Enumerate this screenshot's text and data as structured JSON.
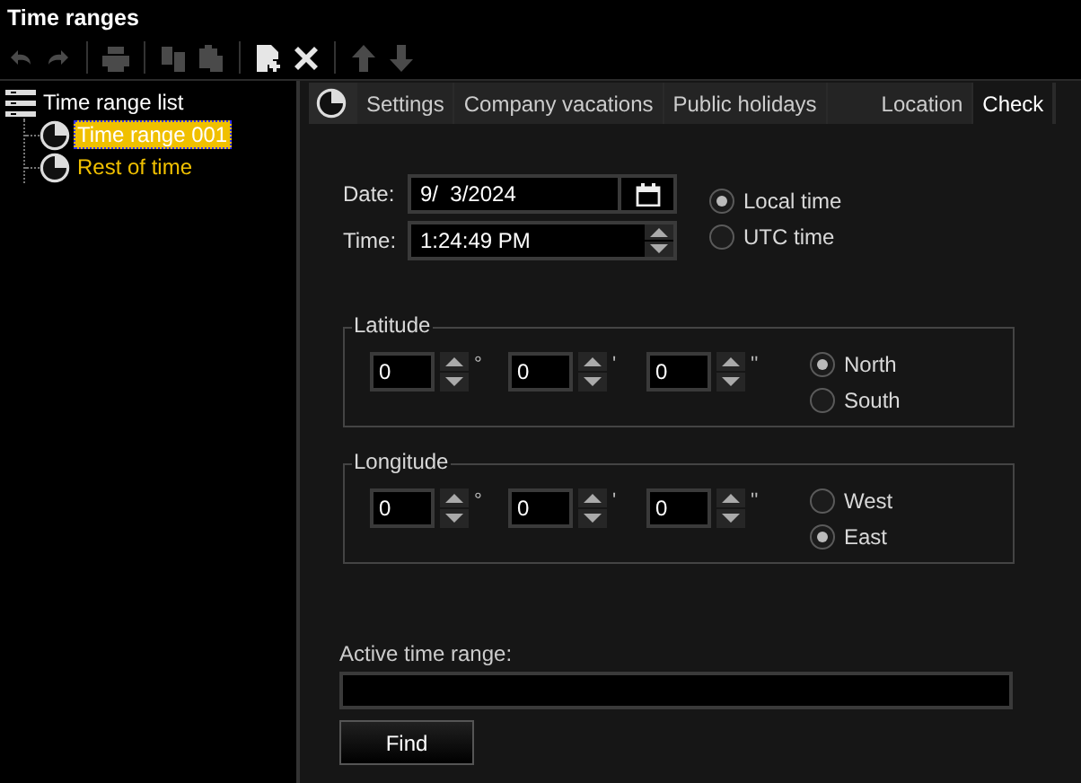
{
  "window": {
    "title": "Time ranges"
  },
  "toolbar": [
    {
      "kind": "undo",
      "disabled": true
    },
    {
      "kind": "redo",
      "disabled": true
    },
    {
      "kind": "print",
      "disabled": true
    },
    {
      "kind": "copy",
      "disabled": true
    },
    {
      "kind": "paste",
      "disabled": true
    },
    {
      "kind": "new",
      "disabled": false
    },
    {
      "kind": "delete",
      "disabled": false
    },
    {
      "kind": "up",
      "disabled": true
    },
    {
      "kind": "down",
      "disabled": true
    }
  ],
  "tree": {
    "label": "Time range list",
    "children": [
      {
        "label": "Time range 001",
        "selected": true
      },
      {
        "label": "Rest of time",
        "selected": false
      }
    ]
  },
  "tabs": [
    {
      "label": "Settings",
      "selected": false
    },
    {
      "label": "Company vacations",
      "selected": false
    },
    {
      "label": "Public holidays",
      "selected": false
    },
    {
      "label": "Location",
      "selected": false
    },
    {
      "label": "Check",
      "selected": true
    }
  ],
  "date": {
    "label": "Date:",
    "value": "9/  3/2024"
  },
  "time": {
    "label": "Time:",
    "value": "1:24:49 PM"
  },
  "time_mode": [
    {
      "label": "Local time",
      "selected": true
    },
    {
      "label": "UTC time",
      "selected": false
    }
  ],
  "latitude": {
    "title": "Latitude",
    "fields": [
      {
        "value": "0",
        "unit": "°"
      },
      {
        "value": "0",
        "unit": "'"
      },
      {
        "value": "0",
        "unit": "''"
      }
    ],
    "options": [
      {
        "label": "North",
        "selected": true
      },
      {
        "label": "South",
        "selected": false
      }
    ]
  },
  "longitude": {
    "title": "Longitude",
    "fields": [
      {
        "value": "0",
        "unit": "°"
      },
      {
        "value": "0",
        "unit": "'"
      },
      {
        "value": "0",
        "unit": "''"
      }
    ],
    "options": [
      {
        "label": "West",
        "selected": false
      },
      {
        "label": "East",
        "selected": true
      }
    ]
  },
  "active_time_range": {
    "label": "Active time range:"
  },
  "find_button": "Find"
}
